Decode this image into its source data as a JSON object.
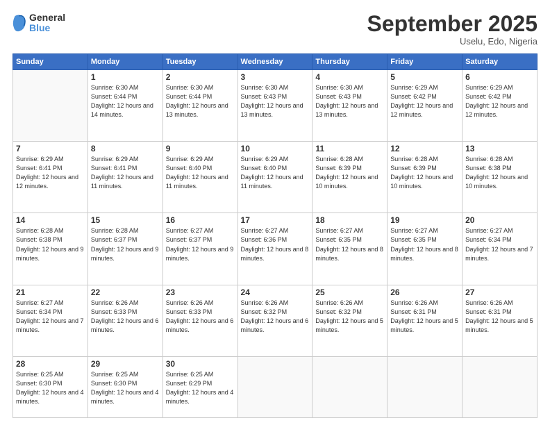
{
  "header": {
    "logo_line1": "General",
    "logo_line2": "Blue",
    "month": "September 2025",
    "location": "Uselu, Edo, Nigeria"
  },
  "weekdays": [
    "Sunday",
    "Monday",
    "Tuesday",
    "Wednesday",
    "Thursday",
    "Friday",
    "Saturday"
  ],
  "weeks": [
    [
      {
        "day": "",
        "sunrise": "",
        "sunset": "",
        "daylight": ""
      },
      {
        "day": "1",
        "sunrise": "6:30 AM",
        "sunset": "6:44 PM",
        "daylight": "12 hours and 14 minutes."
      },
      {
        "day": "2",
        "sunrise": "6:30 AM",
        "sunset": "6:44 PM",
        "daylight": "12 hours and 13 minutes."
      },
      {
        "day": "3",
        "sunrise": "6:30 AM",
        "sunset": "6:43 PM",
        "daylight": "12 hours and 13 minutes."
      },
      {
        "day": "4",
        "sunrise": "6:30 AM",
        "sunset": "6:43 PM",
        "daylight": "12 hours and 13 minutes."
      },
      {
        "day": "5",
        "sunrise": "6:29 AM",
        "sunset": "6:42 PM",
        "daylight": "12 hours and 12 minutes."
      },
      {
        "day": "6",
        "sunrise": "6:29 AM",
        "sunset": "6:42 PM",
        "daylight": "12 hours and 12 minutes."
      }
    ],
    [
      {
        "day": "7",
        "sunrise": "6:29 AM",
        "sunset": "6:41 PM",
        "daylight": "12 hours and 12 minutes."
      },
      {
        "day": "8",
        "sunrise": "6:29 AM",
        "sunset": "6:41 PM",
        "daylight": "12 hours and 11 minutes."
      },
      {
        "day": "9",
        "sunrise": "6:29 AM",
        "sunset": "6:40 PM",
        "daylight": "12 hours and 11 minutes."
      },
      {
        "day": "10",
        "sunrise": "6:29 AM",
        "sunset": "6:40 PM",
        "daylight": "12 hours and 11 minutes."
      },
      {
        "day": "11",
        "sunrise": "6:28 AM",
        "sunset": "6:39 PM",
        "daylight": "12 hours and 10 minutes."
      },
      {
        "day": "12",
        "sunrise": "6:28 AM",
        "sunset": "6:39 PM",
        "daylight": "12 hours and 10 minutes."
      },
      {
        "day": "13",
        "sunrise": "6:28 AM",
        "sunset": "6:38 PM",
        "daylight": "12 hours and 10 minutes."
      }
    ],
    [
      {
        "day": "14",
        "sunrise": "6:28 AM",
        "sunset": "6:38 PM",
        "daylight": "12 hours and 9 minutes."
      },
      {
        "day": "15",
        "sunrise": "6:28 AM",
        "sunset": "6:37 PM",
        "daylight": "12 hours and 9 minutes."
      },
      {
        "day": "16",
        "sunrise": "6:27 AM",
        "sunset": "6:37 PM",
        "daylight": "12 hours and 9 minutes."
      },
      {
        "day": "17",
        "sunrise": "6:27 AM",
        "sunset": "6:36 PM",
        "daylight": "12 hours and 8 minutes."
      },
      {
        "day": "18",
        "sunrise": "6:27 AM",
        "sunset": "6:35 PM",
        "daylight": "12 hours and 8 minutes."
      },
      {
        "day": "19",
        "sunrise": "6:27 AM",
        "sunset": "6:35 PM",
        "daylight": "12 hours and 8 minutes."
      },
      {
        "day": "20",
        "sunrise": "6:27 AM",
        "sunset": "6:34 PM",
        "daylight": "12 hours and 7 minutes."
      }
    ],
    [
      {
        "day": "21",
        "sunrise": "6:27 AM",
        "sunset": "6:34 PM",
        "daylight": "12 hours and 7 minutes."
      },
      {
        "day": "22",
        "sunrise": "6:26 AM",
        "sunset": "6:33 PM",
        "daylight": "12 hours and 6 minutes."
      },
      {
        "day": "23",
        "sunrise": "6:26 AM",
        "sunset": "6:33 PM",
        "daylight": "12 hours and 6 minutes."
      },
      {
        "day": "24",
        "sunrise": "6:26 AM",
        "sunset": "6:32 PM",
        "daylight": "12 hours and 6 minutes."
      },
      {
        "day": "25",
        "sunrise": "6:26 AM",
        "sunset": "6:32 PM",
        "daylight": "12 hours and 5 minutes."
      },
      {
        "day": "26",
        "sunrise": "6:26 AM",
        "sunset": "6:31 PM",
        "daylight": "12 hours and 5 minutes."
      },
      {
        "day": "27",
        "sunrise": "6:26 AM",
        "sunset": "6:31 PM",
        "daylight": "12 hours and 5 minutes."
      }
    ],
    [
      {
        "day": "28",
        "sunrise": "6:25 AM",
        "sunset": "6:30 PM",
        "daylight": "12 hours and 4 minutes."
      },
      {
        "day": "29",
        "sunrise": "6:25 AM",
        "sunset": "6:30 PM",
        "daylight": "12 hours and 4 minutes."
      },
      {
        "day": "30",
        "sunrise": "6:25 AM",
        "sunset": "6:29 PM",
        "daylight": "12 hours and 4 minutes."
      },
      {
        "day": "",
        "sunrise": "",
        "sunset": "",
        "daylight": ""
      },
      {
        "day": "",
        "sunrise": "",
        "sunset": "",
        "daylight": ""
      },
      {
        "day": "",
        "sunrise": "",
        "sunset": "",
        "daylight": ""
      },
      {
        "day": "",
        "sunrise": "",
        "sunset": "",
        "daylight": ""
      }
    ]
  ],
  "labels": {
    "sunrise_prefix": "Sunrise: ",
    "sunset_prefix": "Sunset: ",
    "daylight_prefix": "Daylight: "
  }
}
